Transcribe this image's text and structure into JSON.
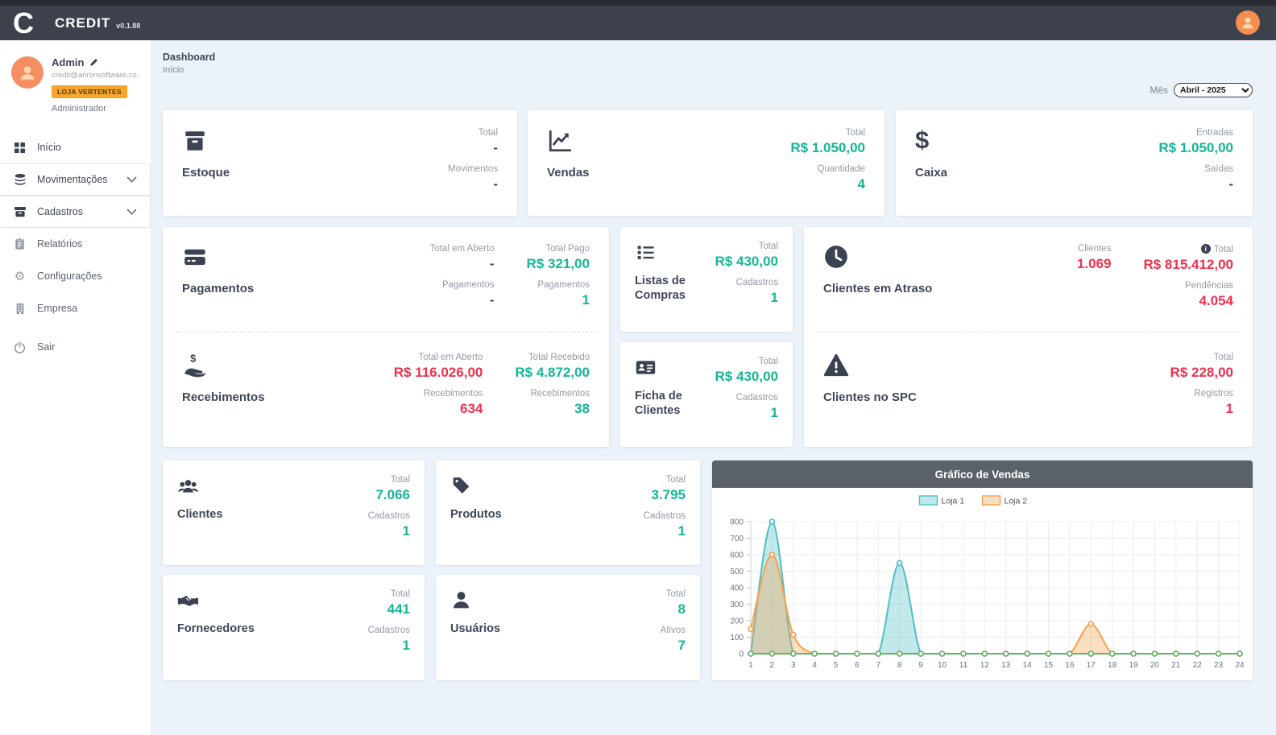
{
  "colors": {
    "teal": "#14b795",
    "red": "#f1304f",
    "navy": "#3c414c",
    "badge_orange": "#f7a62b",
    "chart_header": "#5b6169",
    "loja1": "#4dbfc5",
    "loja2": "#f5a14e",
    "baseline_green": "#5fb464"
  },
  "header": {
    "logo_letter": "C",
    "brand": "CREDIT",
    "version": "v0.1.88"
  },
  "sidebar": {
    "user": {
      "name": "Admin",
      "email": "credit@anronsoftware.co...",
      "badge": "LOJA VERTENTES",
      "role": "Administrador"
    },
    "items": [
      {
        "label": "Início"
      },
      {
        "label": "Movimentações"
      },
      {
        "label": "Cadastros"
      },
      {
        "label": "Relatórios"
      },
      {
        "label": "Configurações"
      },
      {
        "label": "Empresa"
      },
      {
        "label": "Sair"
      }
    ]
  },
  "page": {
    "title": "Dashboard",
    "subtitle": "Início",
    "month_label": "Mês",
    "month_value": "Abril - 2025"
  },
  "cards": {
    "estoque": {
      "title": "Estoque",
      "stats": [
        {
          "label": "Total",
          "value": "-"
        },
        {
          "label": "Movimentos",
          "value": "-"
        }
      ]
    },
    "vendas": {
      "title": "Vendas",
      "stats": [
        {
          "label": "Total",
          "value": "R$ 1.050,00"
        },
        {
          "label": "Quantidade",
          "value": "4"
        }
      ]
    },
    "caixa": {
      "title": "Caixa",
      "stats": [
        {
          "label": "Entradas",
          "value": "R$ 1.050,00"
        },
        {
          "label": "Saídas",
          "value": "-"
        }
      ]
    },
    "pagamentos": {
      "title": "Pagamentos",
      "col1": [
        {
          "label": "Total em Aberto",
          "value": "-"
        },
        {
          "label": "Pagamentos",
          "value": "-"
        }
      ],
      "col2": [
        {
          "label": "Total Pago",
          "value": "R$ 321,00"
        },
        {
          "label": "Pagamentos",
          "value": "1"
        }
      ]
    },
    "recebimentos": {
      "title": "Recebimentos",
      "col1": [
        {
          "label": "Total em Aberto",
          "value": "R$ 116.026,00"
        },
        {
          "label": "Recebimentos",
          "value": "634"
        }
      ],
      "col2": [
        {
          "label": "Total Recebido",
          "value": "R$ 4.872,00"
        },
        {
          "label": "Recebimentos",
          "value": "38"
        }
      ]
    },
    "listas": {
      "title": "Listas de Compras",
      "stats": [
        {
          "label": "Total",
          "value": "R$ 430,00"
        },
        {
          "label": "Cadastros",
          "value": "1"
        }
      ]
    },
    "ficha": {
      "title": "Ficha de Clientes",
      "stats": [
        {
          "label": "Total",
          "value": "R$ 430,00"
        },
        {
          "label": "Cadastros",
          "value": "1"
        }
      ]
    },
    "atraso": {
      "title": "Clientes em Atraso",
      "col1": [
        {
          "label": "Clientes",
          "value": "1.069"
        }
      ],
      "col2": [
        {
          "label": "Total",
          "value": "R$ 815.412,00"
        },
        {
          "label": "Pendências",
          "value": "4.054"
        }
      ]
    },
    "spc": {
      "title": "Clientes no SPC",
      "stats": [
        {
          "label": "Total",
          "value": "R$ 228,00"
        },
        {
          "label": "Registros",
          "value": "1"
        }
      ]
    },
    "clientes": {
      "title": "Clientes",
      "stats": [
        {
          "label": "Total",
          "value": "7.066"
        },
        {
          "label": "Cadastros",
          "value": "1"
        }
      ]
    },
    "produtos": {
      "title": "Produtos",
      "stats": [
        {
          "label": "Total",
          "value": "3.795"
        },
        {
          "label": "Cadastros",
          "value": "1"
        }
      ]
    },
    "fornecedores": {
      "title": "Fornecedores",
      "stats": [
        {
          "label": "Total",
          "value": "441"
        },
        {
          "label": "Cadastros",
          "value": "1"
        }
      ]
    },
    "usuarios": {
      "title": "Usuários",
      "stats": [
        {
          "label": "Total",
          "value": "8"
        },
        {
          "label": "Ativos",
          "value": "7"
        }
      ]
    }
  },
  "chart_data": {
    "type": "line",
    "title": "Gráfico de Vendas",
    "xlabel": "",
    "ylabel": "",
    "x": [
      1,
      2,
      3,
      4,
      5,
      6,
      7,
      8,
      9,
      10,
      11,
      12,
      13,
      14,
      15,
      16,
      17,
      18,
      19,
      20,
      21,
      22,
      23,
      24
    ],
    "ylim": [
      0,
      800
    ],
    "yticks": [
      0,
      100,
      200,
      300,
      400,
      500,
      600,
      700,
      800
    ],
    "grid": true,
    "legend_position": "top",
    "series": [
      {
        "name": "Loja 1",
        "color": "#4dbfc5",
        "legend": true,
        "smooth": true,
        "values": [
          0,
          800,
          0,
          0,
          0,
          0,
          0,
          550,
          0,
          0,
          0,
          0,
          0,
          0,
          0,
          0,
          0,
          0,
          0,
          0,
          0,
          0,
          0,
          0
        ]
      },
      {
        "name": "Loja 2",
        "color": "#f5a14e",
        "legend": true,
        "smooth": true,
        "values": [
          150,
          600,
          115,
          0,
          0,
          0,
          0,
          0,
          0,
          0,
          0,
          0,
          0,
          0,
          0,
          0,
          180,
          0,
          0,
          0,
          0,
          0,
          0,
          0
        ]
      },
      {
        "name": "baseline",
        "color": "#5fb464",
        "legend": false,
        "smooth": false,
        "values": [
          0,
          0,
          0,
          0,
          0,
          0,
          0,
          0,
          0,
          0,
          0,
          0,
          0,
          0,
          0,
          0,
          0,
          0,
          0,
          0,
          0,
          0,
          0,
          0
        ]
      }
    ]
  }
}
